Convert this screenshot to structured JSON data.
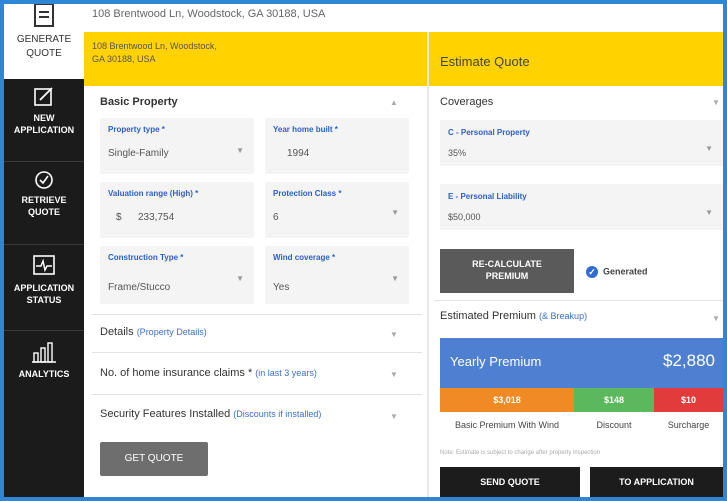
{
  "sidebar": {
    "items": [
      {
        "label1": "GENERATE",
        "label2": "QUOTE",
        "icon": "document-icon"
      },
      {
        "label1": "NEW",
        "label2": "APPLICATION",
        "icon": "edit-icon"
      },
      {
        "label1": "RETRIEVE",
        "label2": "QUOTE",
        "icon": "refresh-icon"
      },
      {
        "label1": "APPLICATION",
        "label2": "STATUS",
        "icon": "pulse-icon"
      },
      {
        "label1": "ANALYTICS",
        "label2": "",
        "icon": "chart-icon"
      }
    ]
  },
  "topbar": {
    "address": "108 Brentwood Ln, Woodstock, GA 30188, USA"
  },
  "header": {
    "address_line1": "108 Brentwood Ln, Woodstock,",
    "address_line2": "GA 30188, USA",
    "estimate_title": "Estimate Quote"
  },
  "basic_property": {
    "title": "Basic Property",
    "fields": {
      "property_type": {
        "label": "Property type *",
        "value": "Single-Family"
      },
      "year_built": {
        "label": "Year home built *",
        "value": "1994"
      },
      "valuation": {
        "label": "Valuation range (High) *",
        "currency": "$",
        "value": "233,754"
      },
      "protection_class": {
        "label": "Protection Class *",
        "value": "6"
      },
      "construction_type": {
        "label": "Construction Type *",
        "value": "Frame/Stucco"
      },
      "wind_coverage": {
        "label": "Wind coverage *",
        "value": "Yes"
      }
    }
  },
  "sections": {
    "details": {
      "title": "Details",
      "hint": "(Property Details)"
    },
    "claims": {
      "title": "No. of home insurance claims *",
      "hint": "(in last 3 years)"
    },
    "security": {
      "title": "Security Features Installed",
      "hint": "(Discounts if installed)"
    }
  },
  "get_quote_label": "GET QUOTE",
  "coverages": {
    "title": "Coverages",
    "personal_property": {
      "label": "C - Personal Property",
      "value": "35%"
    },
    "personal_liability": {
      "label": "E - Personal Liability",
      "value": "$50,000"
    }
  },
  "recalc": {
    "line1": "RE-CALCULATE",
    "line2": "PREMIUM"
  },
  "generated_label": "Generated",
  "estimated_premium": {
    "title": "Estimated Premium",
    "hint": "(& Breakup)"
  },
  "yearly": {
    "label": "Yearly Premium",
    "amount": "$2,880"
  },
  "breakdown": [
    {
      "value": "$3,018",
      "label": "Basic Premium With Wind",
      "color": "#f08a24"
    },
    {
      "value": "$148",
      "label": "Discount",
      "color": "#5cb85c"
    },
    {
      "value": "$10",
      "label": "Surcharge",
      "color": "#e23b3b"
    }
  ],
  "note": "Note: Estimate is subject to change after property inspection",
  "actions": {
    "send_quote": "SEND QUOTE",
    "to_application": "TO APPLICATION"
  },
  "colors": {
    "accent_yellow": "#ffd200",
    "frame_blue": "#2f86d4",
    "premium_blue": "#4f7fd0"
  }
}
